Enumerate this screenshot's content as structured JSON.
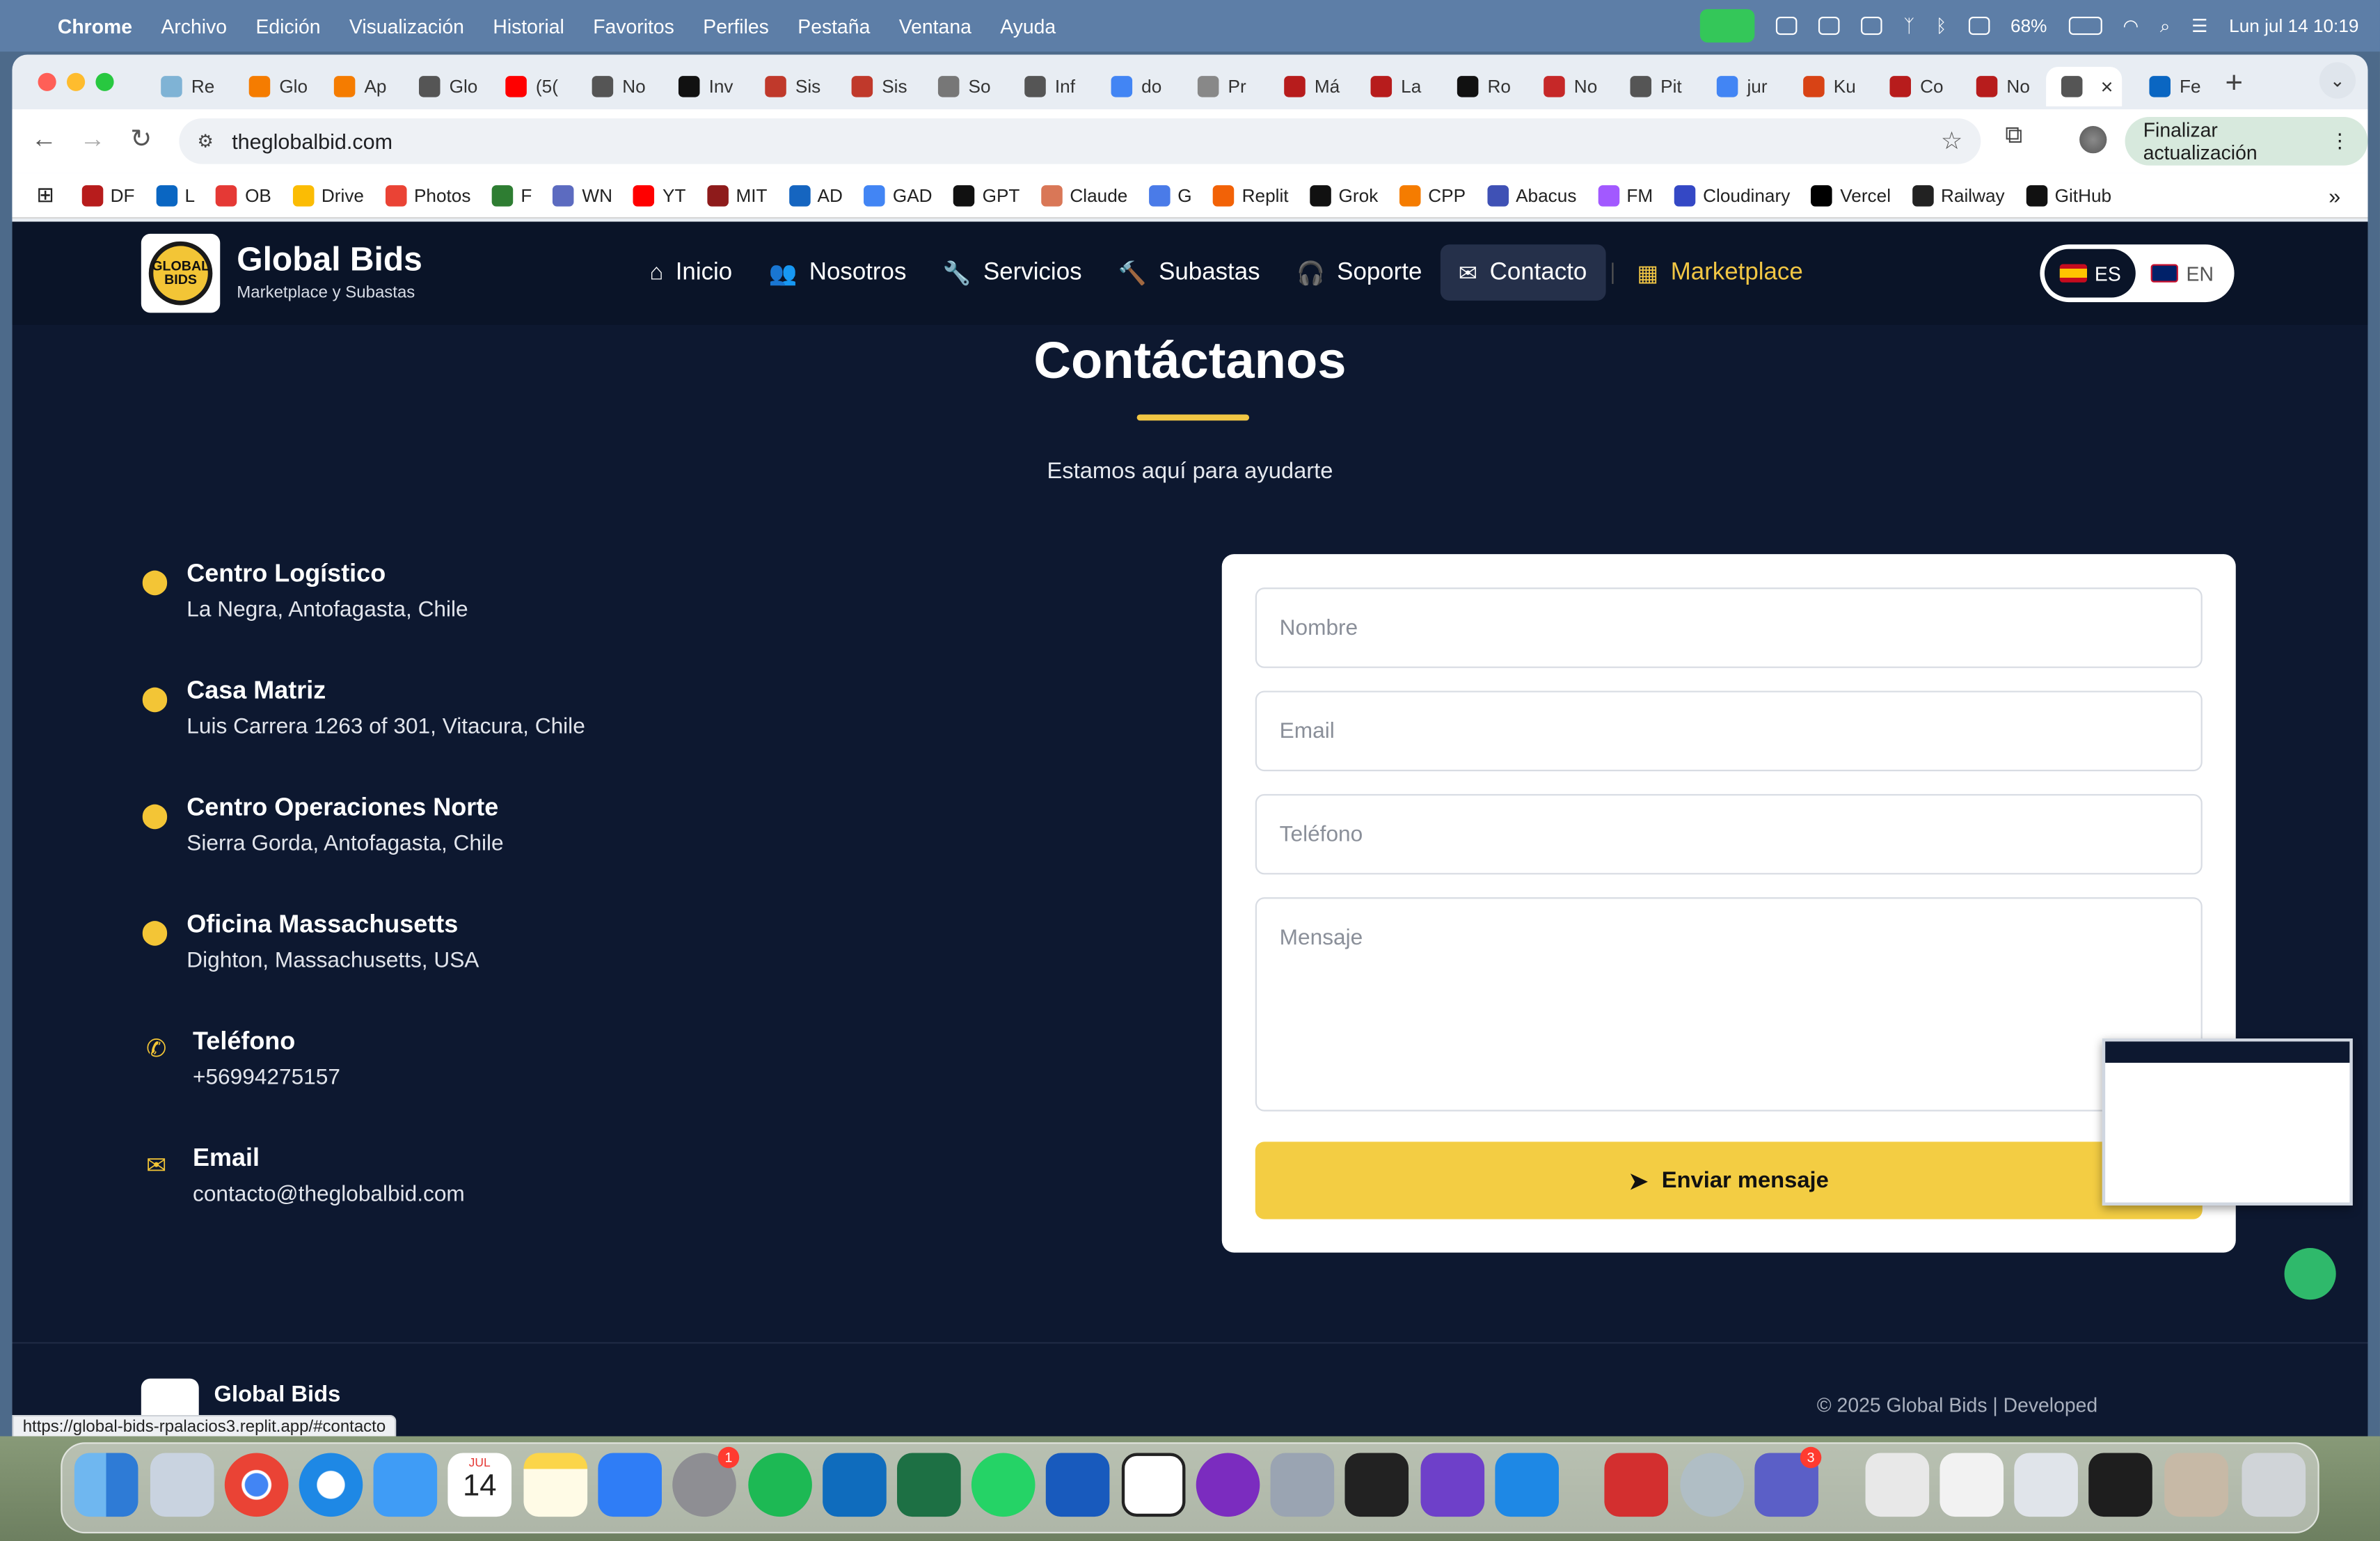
{
  "menubar": {
    "app": "Chrome",
    "items": [
      "Archivo",
      "Edición",
      "Visualización",
      "Historial",
      "Favoritos",
      "Perfiles",
      "Pestaña",
      "Ventana",
      "Ayuda"
    ],
    "battery": "68%",
    "datetime": "Lun jul 14  10:19"
  },
  "tabs": [
    {
      "label": "Re",
      "color": "#7fb3d5"
    },
    {
      "label": "Glo",
      "color": "#f57c00"
    },
    {
      "label": "Ap",
      "color": "#f57c00"
    },
    {
      "label": "Glo",
      "color": "#555555"
    },
    {
      "label": "(5(",
      "color": "#ff0000"
    },
    {
      "label": "No",
      "color": "#555555"
    },
    {
      "label": "Inv",
      "color": "#111111"
    },
    {
      "label": "Sis",
      "color": "#c0392b"
    },
    {
      "label": "Sis",
      "color": "#c0392b"
    },
    {
      "label": "So",
      "color": "#777777"
    },
    {
      "label": "Inf",
      "color": "#555555"
    },
    {
      "label": "do",
      "color": "#4285f4"
    },
    {
      "label": "Pr",
      "color": "#888888"
    },
    {
      "label": "Má",
      "color": "#b71c1c"
    },
    {
      "label": "La",
      "color": "#b71c1c"
    },
    {
      "label": "Ro",
      "color": "#111111"
    },
    {
      "label": "No",
      "color": "#c62828"
    },
    {
      "label": "Pit",
      "color": "#555555"
    },
    {
      "label": "jur",
      "color": "#4285f4"
    },
    {
      "label": "Ku",
      "color": "#d84315"
    },
    {
      "label": "Co",
      "color": "#b71c1c"
    },
    {
      "label": "No",
      "color": "#b71c1c"
    },
    {
      "label": "",
      "color": "#555555",
      "active": true
    },
    {
      "label": "Fe",
      "color": "#0a66c2"
    }
  ],
  "toolbar": {
    "url": "theglobalbid.com",
    "update_label": "Finalizar actualización"
  },
  "bookmarks": [
    {
      "label": "DF",
      "color": "#b71c1c"
    },
    {
      "label": "L",
      "color": "#0a66c2"
    },
    {
      "label": "OB",
      "color": "#e53935"
    },
    {
      "label": "Drive",
      "color": "#fbbc04"
    },
    {
      "label": "Photos",
      "color": "#ea4335"
    },
    {
      "label": "F",
      "color": "#2e7d32"
    },
    {
      "label": "WN",
      "color": "#5c6bc0"
    },
    {
      "label": "YT",
      "color": "#ff0000"
    },
    {
      "label": "MIT",
      "color": "#8e1b1b"
    },
    {
      "label": "AD",
      "color": "#1565c0"
    },
    {
      "label": "GAD",
      "color": "#4285f4"
    },
    {
      "label": "GPT",
      "color": "#111111"
    },
    {
      "label": "Claude",
      "color": "#d97757"
    },
    {
      "label": "G",
      "color": "#4a7be8"
    },
    {
      "label": "Replit",
      "color": "#f26207"
    },
    {
      "label": "Grok",
      "color": "#111111"
    },
    {
      "label": "CPP",
      "color": "#f57c00"
    },
    {
      "label": "Abacus",
      "color": "#3f51b5"
    },
    {
      "label": "FM",
      "color": "#a259ff"
    },
    {
      "label": "Cloudinary",
      "color": "#3448c5"
    },
    {
      "label": "Vercel",
      "color": "#000000"
    },
    {
      "label": "Railway",
      "color": "#222222"
    },
    {
      "label": "GitHub",
      "color": "#111111"
    }
  ],
  "site": {
    "brand": "Global Bids",
    "tagline": "Marketplace y Subastas",
    "logo_text": "GLOBAL BIDS",
    "nav": [
      {
        "label": "Inicio",
        "icon": "home-icon"
      },
      {
        "label": "Nosotros",
        "icon": "users-icon"
      },
      {
        "label": "Servicios",
        "icon": "wrench-icon"
      },
      {
        "label": "Subastas",
        "icon": "gavel-icon"
      },
      {
        "label": "Soporte",
        "icon": "headset-icon"
      },
      {
        "label": "Contacto",
        "icon": "envelope-icon",
        "active": true
      },
      {
        "label": "Marketplace",
        "icon": "grid-icon"
      }
    ],
    "lang": {
      "es": "ES",
      "en": "EN",
      "active": "ES"
    }
  },
  "contact": {
    "title": "Contáctanos",
    "subtitle": "Estamos aquí para ayudarte",
    "locations": [
      {
        "title": "Centro Logístico",
        "detail": "La Negra, Antofagasta, Chile",
        "icon": "map-pin-icon"
      },
      {
        "title": "Casa Matriz",
        "detail": "Luis Carrera 1263 of 301, Vitacura, Chile",
        "icon": "map-pin-icon"
      },
      {
        "title": "Centro Operaciones Norte",
        "detail": "Sierra Gorda, Antofagasta, Chile",
        "icon": "map-pin-icon"
      },
      {
        "title": "Oficina Massachusetts",
        "detail": "Dighton, Massachusetts, USA",
        "icon": "map-pin-icon"
      },
      {
        "title": "Teléfono",
        "detail": "+56994275157",
        "icon": "phone-icon"
      },
      {
        "title": "Email",
        "detail": "contacto@theglobalbid.com",
        "icon": "envelope-icon"
      }
    ],
    "form": {
      "name_placeholder": "Nombre",
      "email_placeholder": "Email",
      "phone_placeholder": "Teléfono",
      "message_placeholder": "Mensaje",
      "submit_label": "Enviar mensaje"
    }
  },
  "footer": {
    "brand": "Global Bids",
    "copyright": "© 2025 Global Bids  |  Developed"
  },
  "status_url": "https://global-bids-rpalacios3.replit.app/#contacto",
  "dock": {
    "calendar_month": "JUL",
    "calendar_day": "14",
    "badges": {
      "system_settings": "1",
      "teams": "3"
    }
  },
  "colors": {
    "accent": "#f3cd43",
    "page_bg": "#0d1830",
    "nav_bg": "#0a1428"
  }
}
